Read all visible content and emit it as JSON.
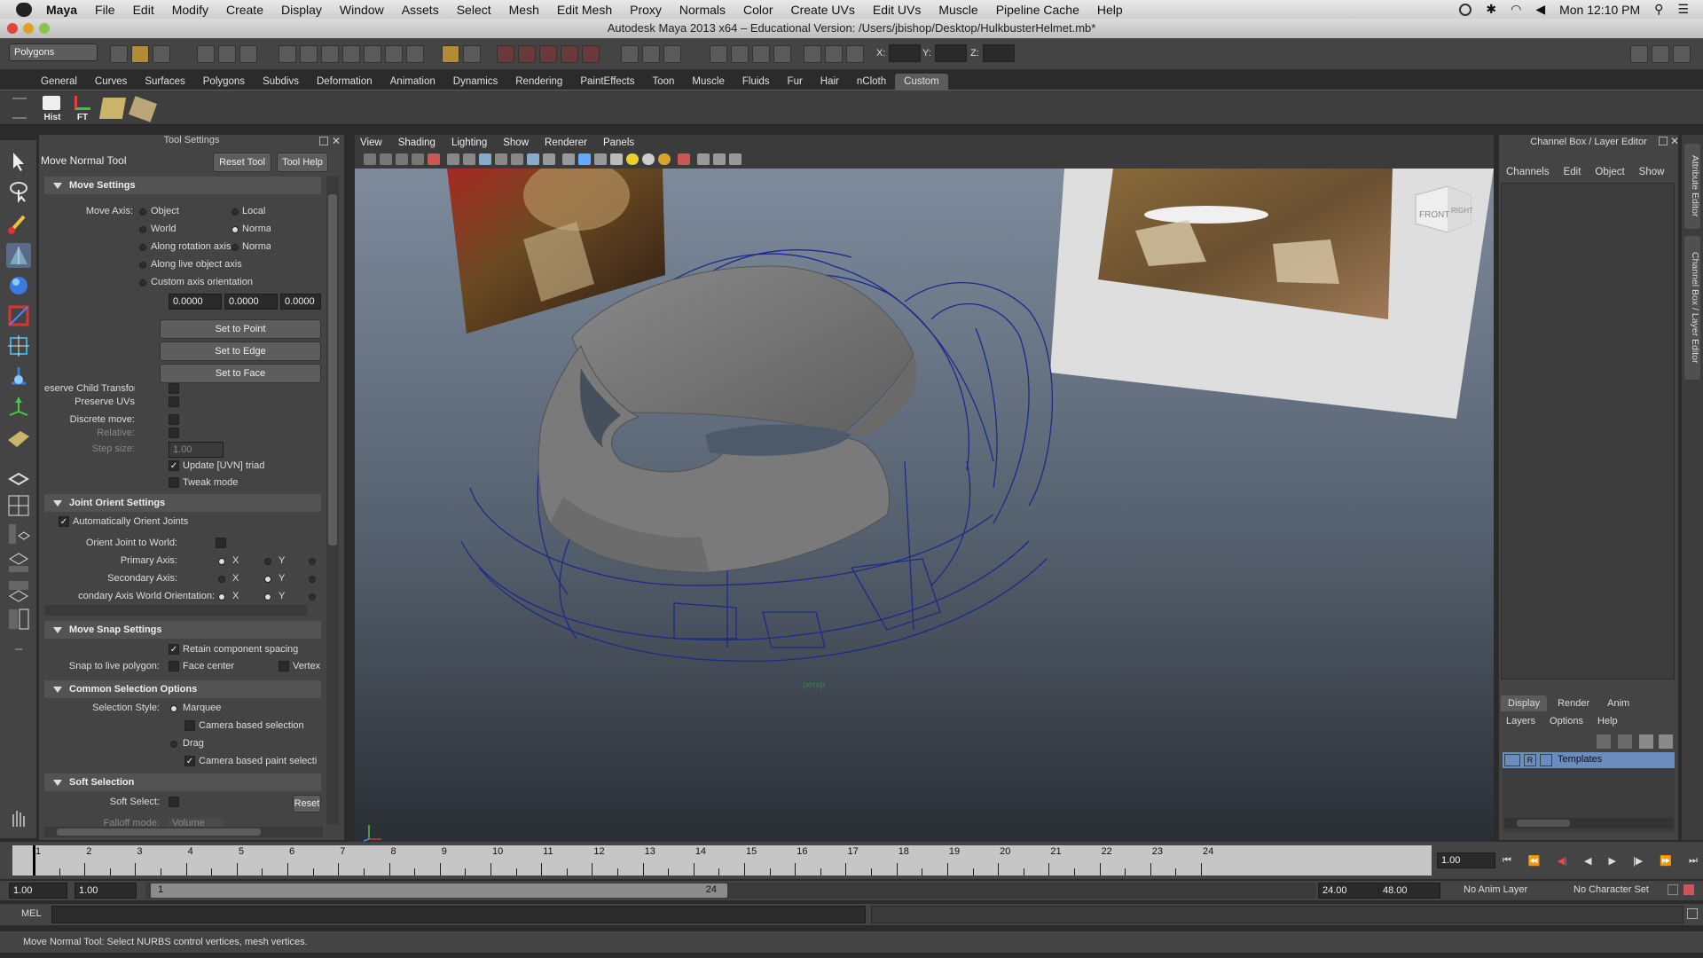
{
  "menubar": {
    "items": [
      "Maya",
      "File",
      "Edit",
      "Modify",
      "Create",
      "Display",
      "Window",
      "Assets",
      "Select",
      "Mesh",
      "Edit Mesh",
      "Proxy",
      "Normals",
      "Color",
      "Create UVs",
      "Edit UVs",
      "Muscle",
      "Pipeline Cache",
      "Help"
    ],
    "clock": "Mon 12:10 PM"
  },
  "window": {
    "title": "Autodesk Maya 2013 x64 – Educational Version: /Users/jbishop/Desktop/HulkbusterHelmet.mb*"
  },
  "statusline": {
    "mode": "Polygons",
    "x_label": "X:",
    "y_label": "Y:",
    "z_label": "Z:"
  },
  "shelf": {
    "tabs": [
      "General",
      "Curves",
      "Surfaces",
      "Polygons",
      "Subdivs",
      "Deformation",
      "Animation",
      "Dynamics",
      "Rendering",
      "PaintEffects",
      "Toon",
      "Muscle",
      "Fluids",
      "Fur",
      "Hair",
      "nCloth",
      "Custom"
    ],
    "active_tab": "Custom",
    "buttons": [
      {
        "label": "Hist"
      },
      {
        "label": "FT"
      },
      {
        "label": ""
      },
      {
        "label": ""
      }
    ]
  },
  "tool_settings": {
    "panel_title": "Tool Settings",
    "tool_name": "Move Normal Tool",
    "reset_tool": "Reset Tool",
    "tool_help": "Tool Help",
    "move_settings": {
      "header": "Move Settings",
      "move_axis_label": "Move Axis:",
      "options": [
        "Object",
        "Local",
        "World",
        "Norma",
        "Along rotation axis",
        "Norma",
        "Along live object axis",
        "Custom axis orientation"
      ],
      "values": [
        "0.0000",
        "0.0000",
        "0.0000"
      ],
      "set_to_point": "Set to Point",
      "set_to_edge": "Set to Edge",
      "set_to_face": "Set to Face",
      "preserve_child": "eserve Child Transform",
      "preserve_uvs": "Preserve UVs",
      "discrete_move": "Discrete move:",
      "relative": "Relative:",
      "step_size": "Step size:",
      "step_value": "1.00",
      "update_triad": "Update [UVN] triad",
      "tweak_mode": "Tweak mode"
    },
    "joint_orient": {
      "header": "Joint Orient Settings",
      "auto_orient": "Automatically Orient Joints",
      "orient_world": "Orient Joint to World:",
      "primary_axis": "Primary Axis:",
      "secondary_axis": "Secondary Axis:",
      "secondary_world": "condary Axis World Orientation:",
      "x": "X",
      "y": "Y"
    },
    "move_snap": {
      "header": "Move Snap Settings",
      "retain": "Retain component spacing",
      "snap_live": "Snap to live polygon:",
      "face_center": "Face center",
      "vertex": "Vertex"
    },
    "common_selection": {
      "header": "Common Selection Options",
      "selection_style": "Selection Style:",
      "marquee": "Marquee",
      "camera_based": "Camera based selection",
      "drag": "Drag",
      "camera_paint": "Camera based paint selecti"
    },
    "soft_selection": {
      "header": "Soft Selection",
      "soft_select": "Soft Select:",
      "reset": "Reset",
      "falloff_mode": "Falloff mode:",
      "falloff_value": "Volume"
    }
  },
  "viewport": {
    "menu": [
      "View",
      "Shading",
      "Lighting",
      "Show",
      "Renderer",
      "Panels"
    ],
    "viewcube": [
      "FRONT",
      "RIGHT"
    ],
    "camera": "persp"
  },
  "channel_box": {
    "title": "Channel Box / Layer Editor",
    "menu": [
      "Channels",
      "Edit",
      "Object",
      "Show"
    ],
    "layer_tabs": [
      "Display",
      "Render",
      "Anim"
    ],
    "active_layer_tab": "Display",
    "layer_menu": [
      "Layers",
      "Options",
      "Help"
    ],
    "layer": {
      "flag": "R",
      "name": "Templates"
    }
  },
  "side_tabs": [
    "Attribute Editor",
    "Channel Box / Layer Editor"
  ],
  "timeline": {
    "ticks": [
      "1",
      "2",
      "3",
      "4",
      "5",
      "6",
      "7",
      "8",
      "9",
      "10",
      "11",
      "12",
      "13",
      "14",
      "15",
      "16",
      "17",
      "18",
      "19",
      "20",
      "21",
      "22",
      "23",
      "24"
    ],
    "current_frame": "1.00"
  },
  "range": {
    "start": "1.00",
    "playback_start": "1.00",
    "slider_start": "1",
    "slider_end": "24",
    "playback_end": "24.00",
    "end": "48.00",
    "anim_layer": "No Anim Layer",
    "character_set": "No Character Set"
  },
  "command_line": {
    "label": "MEL"
  },
  "help_line": {
    "text": "Move Normal Tool: Select NURBS control vertices, mesh vertices."
  }
}
